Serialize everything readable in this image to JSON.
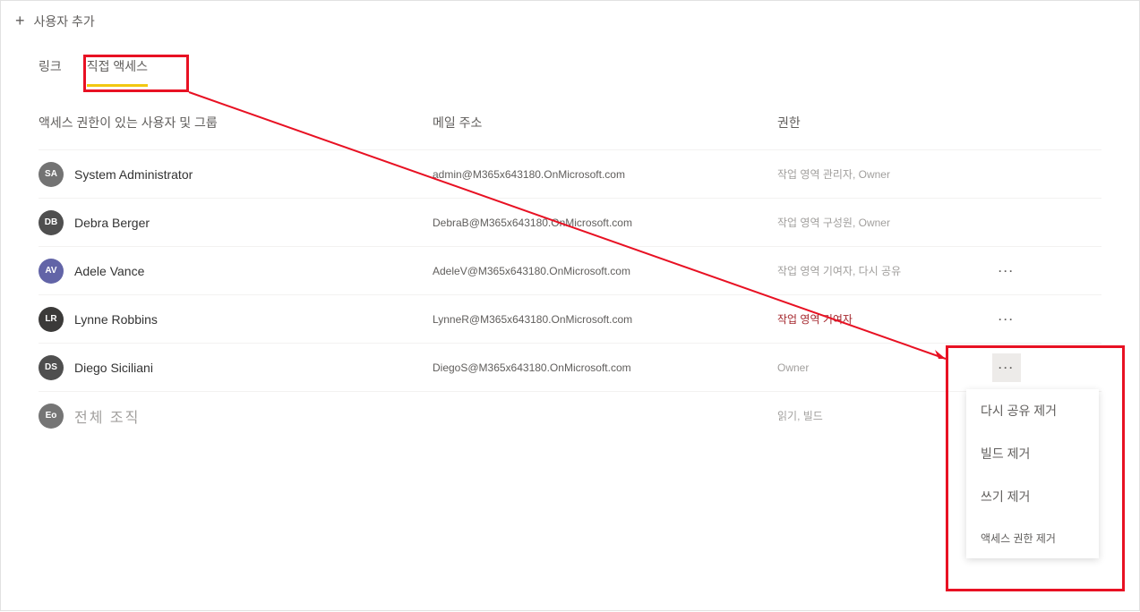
{
  "toolbar": {
    "add_user_label": "사용자 추가"
  },
  "tabs": {
    "links": "링크",
    "direct_access": "직접 액세스"
  },
  "headers": {
    "users_groups": "액세스 권한이 있는 사용자 및 그룹",
    "email": "메일 주소",
    "permission": "권한"
  },
  "rows": [
    {
      "initials": "SA",
      "avatar_class": "sa",
      "name": "System Administrator",
      "email": "admin@M365x643180.OnMicrosoft.com",
      "permission": "작업 영역 관리자, Owner",
      "show_more": false
    },
    {
      "initials": "DB",
      "avatar_class": "db",
      "name": "Debra Berger",
      "email": "DebraB@M365x643180.OnMicrosoft.com",
      "permission": "작업 영역 구성원, Owner",
      "show_more": false
    },
    {
      "initials": "AV",
      "avatar_class": "av",
      "name": "Adele Vance",
      "email": "AdeleV@M365x643180.OnMicrosoft.com",
      "permission": "작업 영역 기여자, 다시 공유",
      "show_more": true
    },
    {
      "initials": "LR",
      "avatar_class": "lr",
      "name": "Lynne Robbins",
      "email": "LynneR@M365x643180.OnMicrosoft.com",
      "permission": "작업 영역 기여자",
      "perm_highlight": true,
      "show_more": true
    },
    {
      "initials": "DS",
      "avatar_class": "ds",
      "name": "Diego Siciliani",
      "email": "DiegoS@M365x643180.OnMicrosoft.com",
      "permission": "Owner",
      "show_more": true,
      "more_active": true
    },
    {
      "initials": "Eo",
      "avatar_class": "eo",
      "name": "전체 조직",
      "muted": true,
      "email": "",
      "permission": "읽기, 빌드",
      "show_more": false
    }
  ],
  "context_menu": {
    "remove_reshare": "다시 공유 제거",
    "remove_build": "빌드 제거",
    "remove_write": "쓰기 제거",
    "remove_access": "액세스 권한 제거"
  }
}
